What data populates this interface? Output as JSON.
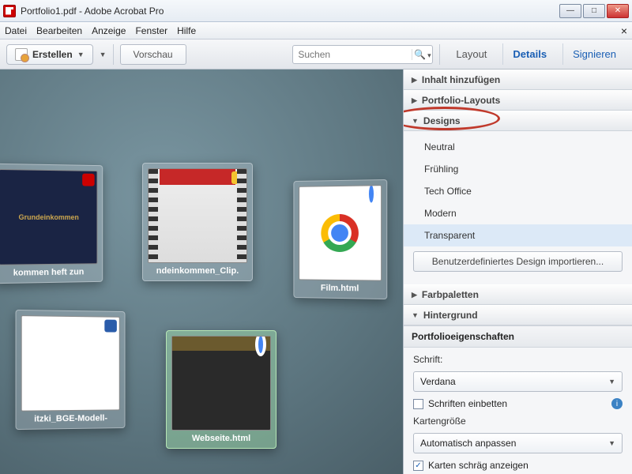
{
  "window": {
    "title": "Portfolio1.pdf - Adobe Acrobat Pro"
  },
  "menu": {
    "file": "Datei",
    "edit": "Bearbeiten",
    "view": "Anzeige",
    "window": "Fenster",
    "help": "Hilfe"
  },
  "toolbar": {
    "create": "Erstellen",
    "preview": "Vorschau",
    "search_placeholder": "Suchen",
    "tabs": {
      "layout": "Layout",
      "details": "Details",
      "sign": "Signieren"
    }
  },
  "thumbs": [
    {
      "id": "t1",
      "label": "kommen heft zun",
      "kind": "dark",
      "caption": "Grundeinkommen"
    },
    {
      "id": "t2",
      "label": "ndeinkommen_Clip.",
      "kind": "film"
    },
    {
      "id": "t3",
      "label": "Film.html",
      "kind": "chrome"
    },
    {
      "id": "t4",
      "label": "itzki_BGE-Modell-",
      "kind": "doc"
    },
    {
      "id": "t5",
      "label": "Webseite.html",
      "kind": "web",
      "selected": true
    }
  ],
  "panel": {
    "sections": {
      "add": "Inhalt hinzufügen",
      "layouts": "Portfolio-Layouts",
      "designs": "Designs",
      "palettes": "Farbpaletten",
      "background": "Hintergrund"
    },
    "designs": [
      "Neutral",
      "Frühling",
      "Tech Office",
      "Modern",
      "Transparent"
    ],
    "designs_selected": "Transparent",
    "import_design": "Benutzerdefiniertes Design importieren...",
    "props_title": "Portfolioeigenschaften",
    "font_label": "Schrift:",
    "font_value": "Verdana",
    "embed_fonts": "Schriften einbetten",
    "card_size_label": "Kartengröße",
    "card_size_value": "Automatisch anpassen",
    "tilt_cards": "Karten schräg anzeigen"
  }
}
